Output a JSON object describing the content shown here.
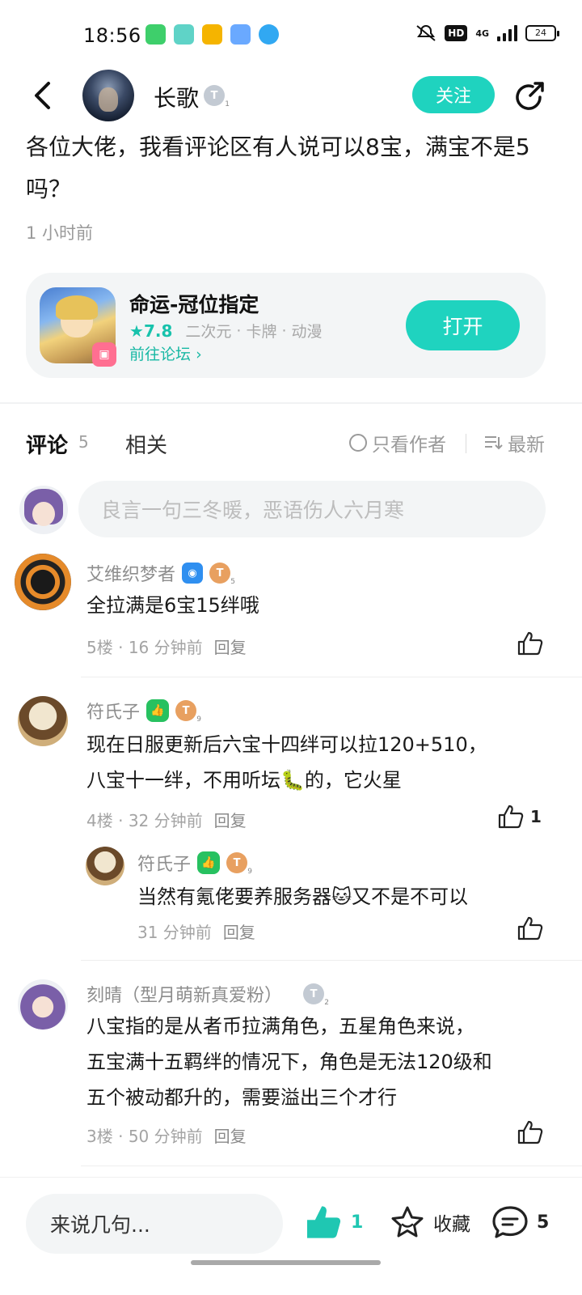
{
  "status_bar": {
    "time": "18:56",
    "hd": "HD",
    "network": "4G",
    "battery": "24",
    "app_icons": [
      {
        "name": "messages-icon",
        "color": "#3ecf6b"
      },
      {
        "name": "circle-app-icon",
        "color": "#5fd3c7"
      },
      {
        "name": "weibo-icon",
        "color": "#f5b400"
      },
      {
        "name": "wallet-icon",
        "color": "#6aa9ff"
      },
      {
        "name": "qq-icon",
        "color": "#31a8f2"
      }
    ]
  },
  "header": {
    "author": "长歌",
    "author_level": "T",
    "author_level_num": "1",
    "follow_label": "关注"
  },
  "post": {
    "body": "各位大佬，我看评论区有人说可以8宝，满宝不是5吗？",
    "time": "1 小时前"
  },
  "game_card": {
    "title": "命运-冠位指定",
    "rating": "7.8",
    "tags": [
      "二次元",
      "卡牌",
      "动漫"
    ],
    "forum_link": "前往论坛",
    "open_label": "打开"
  },
  "tabs": {
    "comments_label": "评论",
    "comments_count": "5",
    "related_label": "相关",
    "author_only": "只看作者",
    "sort": "最新"
  },
  "comment_input_placeholder": "良言一句三冬暖，恶语伤人六月寒",
  "comments": [
    {
      "name": "艾维织梦者",
      "level": "T",
      "level_num": "5",
      "text": "全拉满是6宝15绊哦",
      "floor": "5楼",
      "time": "16 分钟前",
      "reply": "回复"
    },
    {
      "name": "符氏子",
      "level": "T",
      "level_num": "9",
      "text_line1": "现在日服更新后六宝十四绊可以拉120+510，",
      "text_line2": "八宝十一绊，不用听坛🐛的，它火星",
      "floor": "4楼",
      "time": "32 分钟前",
      "reply": "回复",
      "likes": "1",
      "sub_reply": {
        "name": "符氏子",
        "level": "T",
        "level_num": "9",
        "text": "当然有氪佬要养服务器🐱又不是不可以",
        "time": "31 分钟前",
        "reply": "回复"
      }
    },
    {
      "name": "刻晴（型月萌新真爱粉）",
      "level": "T",
      "level_num": "2",
      "text_line1": "八宝指的是从者币拉满角色，五星角色来说，",
      "text_line2": "五宝满十五羁绊的情况下，角色是无法120级和",
      "text_line3": "五个被动都升的，需要溢出三个才行",
      "floor": "3楼",
      "time": "50 分钟前",
      "reply": "回复"
    }
  ],
  "bottom_bar": {
    "input_placeholder": "来说几句...",
    "like_count": "1",
    "favorite_label": "收藏",
    "comment_count": "5"
  },
  "colors": {
    "accent": "#1fd3bf",
    "muted_text": "#9a9a9a"
  }
}
